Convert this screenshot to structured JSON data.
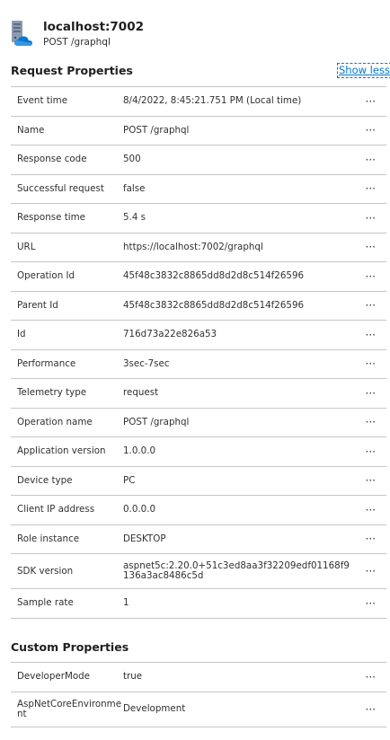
{
  "header": {
    "title": "localhost:7002",
    "subtitle": "POST /graphql"
  },
  "request_section": {
    "title": "Request Properties",
    "toggle_label": "Show less",
    "rows": [
      {
        "key": "Event time",
        "value": "8/4/2022, 8:45:21.751 PM (Local time)"
      },
      {
        "key": "Name",
        "value": "POST /graphql"
      },
      {
        "key": "Response code",
        "value": "500"
      },
      {
        "key": "Successful request",
        "value": "false"
      },
      {
        "key": "Response time",
        "value": "5.4 s"
      },
      {
        "key": "URL",
        "value": "https://localhost:7002/graphql"
      },
      {
        "key": "Operation Id",
        "value": "45f48c3832c8865dd8d2d8c514f26596"
      },
      {
        "key": "Parent Id",
        "value": "45f48c3832c8865dd8d2d8c514f26596"
      },
      {
        "key": "Id",
        "value": "716d73a22e826a53"
      },
      {
        "key": "Performance",
        "value": "3sec-7sec"
      },
      {
        "key": "Telemetry type",
        "value": "request"
      },
      {
        "key": "Operation name",
        "value": "POST /graphql"
      },
      {
        "key": "Application version",
        "value": "1.0.0.0"
      },
      {
        "key": "Device type",
        "value": "PC"
      },
      {
        "key": "Client IP address",
        "value": "0.0.0.0"
      },
      {
        "key": "Role instance",
        "value": "DESKTOP"
      },
      {
        "key": "SDK version",
        "value": "aspnet5c:2.20.0+51c3ed8aa3f32209edf01168f9136a3ac8486c5d"
      },
      {
        "key": "Sample rate",
        "value": "1"
      }
    ]
  },
  "custom_section": {
    "title": "Custom Properties",
    "rows": [
      {
        "key": "DeveloperMode",
        "value": "true"
      },
      {
        "key": "AspNetCoreEnvironment",
        "value": "Development"
      }
    ]
  },
  "row_action_glyph": "···",
  "colors": {
    "link": "#0078d4",
    "border": "#c8c6c4",
    "text": "#323130",
    "icon_server": "#8a9bb0",
    "icon_cloud": "#0078d4"
  }
}
